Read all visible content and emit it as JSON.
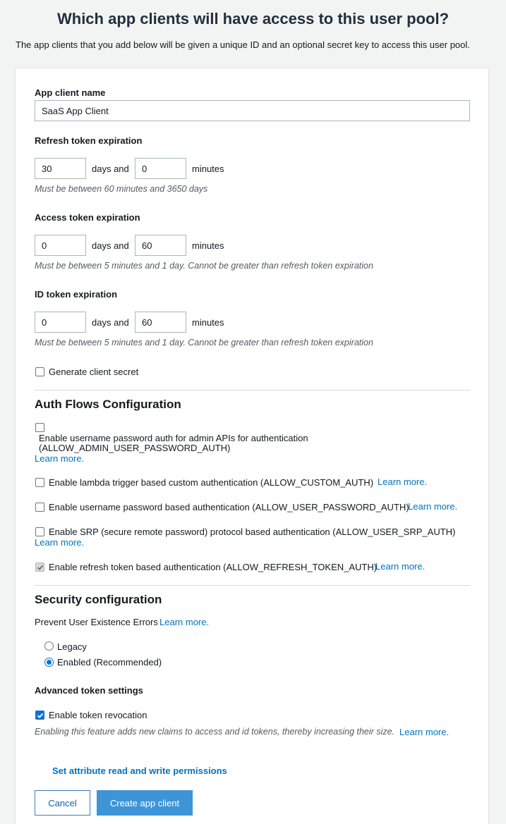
{
  "header": {
    "title": "Which app clients will have access to this user pool?",
    "subtitle": "The app clients that you add below will be given a unique ID and an optional secret key to access this user pool."
  },
  "app_client": {
    "label": "App client name",
    "value": "SaaS App Client"
  },
  "refresh_token": {
    "label": "Refresh token expiration",
    "days_value": "30",
    "minutes_value": "0",
    "hint": "Must be between 60 minutes and 3650 days"
  },
  "access_token": {
    "label": "Access token expiration",
    "days_value": "0",
    "minutes_value": "60",
    "hint": "Must be between 5 minutes and 1 day. Cannot be greater than refresh token expiration"
  },
  "id_token": {
    "label": "ID token expiration",
    "days_value": "0",
    "minutes_value": "60",
    "hint": "Must be between 5 minutes and 1 day. Cannot be greater than refresh token expiration"
  },
  "units": {
    "days_and": "days and",
    "minutes": "minutes"
  },
  "client_secret": {
    "label": "Generate client secret",
    "checked": false
  },
  "auth_flows": {
    "title": "Auth Flows Configuration",
    "learn_more": "Learn more.",
    "items": [
      {
        "label_line1": "Enable username password auth for admin APIs for authentication",
        "label_line2": "(ALLOW_ADMIN_USER_PASSWORD_AUTH)",
        "checked": false
      },
      {
        "label": "Enable lambda trigger based custom authentication (ALLOW_CUSTOM_AUTH)",
        "checked": false
      },
      {
        "label": "Enable username password based authentication (ALLOW_USER_PASSWORD_AUTH)",
        "checked": false
      },
      {
        "label": "Enable SRP (secure remote password) protocol based authentication (ALLOW_USER_SRP_AUTH)",
        "checked": false
      },
      {
        "label": "Enable refresh token based authentication (ALLOW_REFRESH_TOKEN_AUTH)",
        "checked": true
      }
    ]
  },
  "security": {
    "title": "Security configuration",
    "prevent_label": "Prevent User Existence Errors",
    "learn_more": "Learn more.",
    "options": [
      "Legacy",
      "Enabled (Recommended)"
    ],
    "selected": "Enabled (Recommended)"
  },
  "advanced": {
    "label": "Advanced token settings",
    "revocation_label": "Enable token revocation",
    "revocation_checked": true,
    "hint": "Enabling this feature adds new claims to access and id tokens, thereby increasing their size.",
    "learn_more": "Learn more."
  },
  "actions": {
    "attribute_link": "Set attribute read and write permissions",
    "cancel": "Cancel",
    "create": "Create app client"
  },
  "colors": {
    "link": "#0073bb",
    "primary": "#3d95d8",
    "checkbox_checked": "#0b72d9"
  }
}
